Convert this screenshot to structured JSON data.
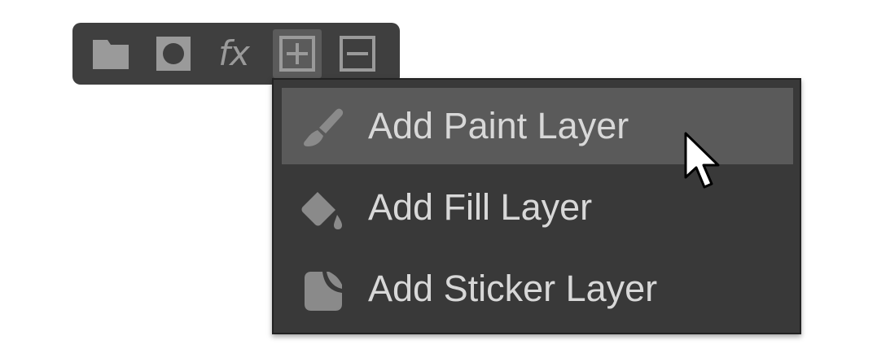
{
  "toolbar": {
    "buttons": [
      {
        "name": "new-folder",
        "icon": "folder-icon"
      },
      {
        "name": "add-mask",
        "icon": "mask-icon"
      },
      {
        "name": "add-effect",
        "icon": "fx-icon",
        "label": "fx"
      },
      {
        "name": "add-layer",
        "icon": "plus-square-icon",
        "active": true
      },
      {
        "name": "remove-layer",
        "icon": "minus-square-icon"
      }
    ]
  },
  "menu": {
    "items": [
      {
        "label": "Add Paint Layer",
        "icon": "paint-brush-icon",
        "highlighted": true
      },
      {
        "label": "Add Fill Layer",
        "icon": "paint-bucket-icon",
        "highlighted": false
      },
      {
        "label": "Add Sticker Layer",
        "icon": "sticker-icon",
        "highlighted": false
      }
    ]
  },
  "colors": {
    "toolbar_bg": "#3f3f3f",
    "menu_bg": "#393939",
    "highlight_bg": "#5a5a5a",
    "icon_gray": "#9a9a9a",
    "text": "#d8d8d8"
  }
}
